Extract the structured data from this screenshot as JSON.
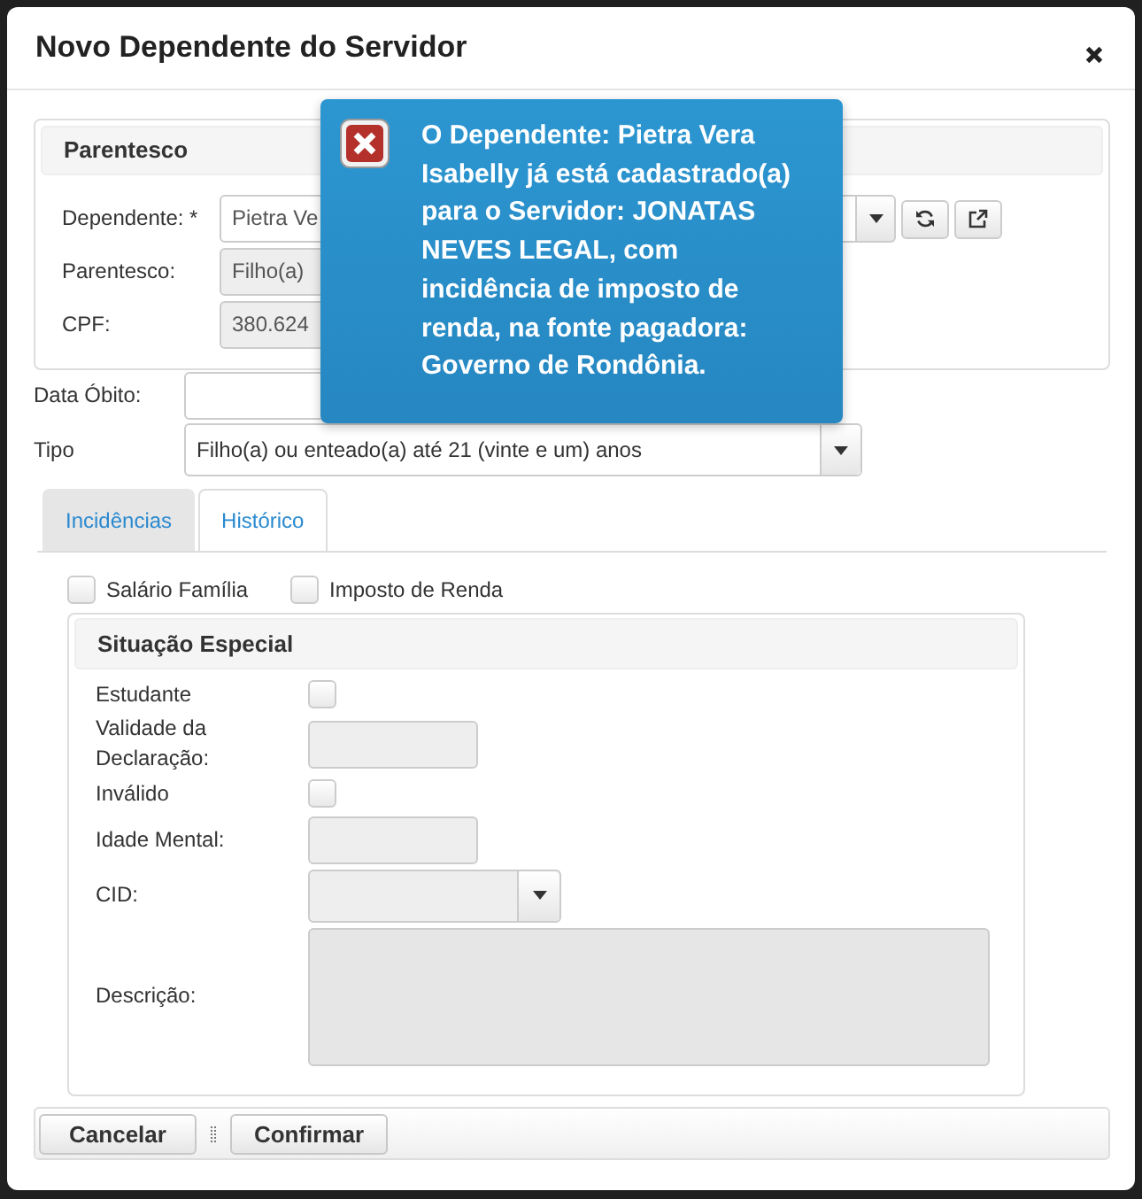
{
  "dialog": {
    "title": "Novo Dependente do Servidor"
  },
  "parentesco": {
    "title": "Parentesco",
    "fields": [
      {
        "kind": "autocomplete",
        "label": "Dependente: *",
        "value": "Pietra Ve",
        "disabled": false
      },
      {
        "kind": "text",
        "label": "Parentesco:",
        "value": "Filho(a)",
        "disabled": true
      },
      {
        "kind": "text",
        "label": "CPF:",
        "value": "380.624",
        "disabled": true
      }
    ]
  },
  "fields": [
    {
      "kind": "text",
      "label": "Data Óbito:",
      "disabled": false
    },
    {
      "kind": "select",
      "label": "Tipo",
      "value": "Filho(a) ou enteado(a) até 21 (vinte e um) anos",
      "disabled": false
    }
  ],
  "tabs": [
    {
      "label": "Incidências",
      "selected": true
    },
    {
      "label": "Histórico",
      "selected": false
    }
  ],
  "incidencias": [
    {
      "label": "Salário Família",
      "checked": false
    },
    {
      "label": "Imposto de Renda",
      "checked": false
    }
  ],
  "situacao_especial": {
    "title": "Situação Especial",
    "fields": [
      {
        "kind": "checkbox",
        "label": "Estudante",
        "checked": false,
        "disabled": false
      },
      {
        "kind": "text",
        "label": "Validade da Declaração:",
        "disabled": true
      },
      {
        "kind": "checkbox",
        "label": "Inválido",
        "checked": false,
        "disabled": false
      },
      {
        "kind": "text",
        "label": "Idade Mental:",
        "disabled": true
      },
      {
        "kind": "select",
        "label": "CID:",
        "disabled": true
      },
      {
        "kind": "textarea",
        "label": "Descrição:",
        "disabled": true
      }
    ]
  },
  "buttons": [
    {
      "label": "Cancelar"
    },
    {
      "label": "Confirmar"
    }
  ],
  "toast": {
    "kind": "error",
    "message": "O Dependente: Pietra Vera Isabelly já está cadastrado(a) para o Servidor: JONATAS NEVES LEGAL, com incidência de imposto de renda, na fonte pagadora: Governo de Rondônia."
  }
}
